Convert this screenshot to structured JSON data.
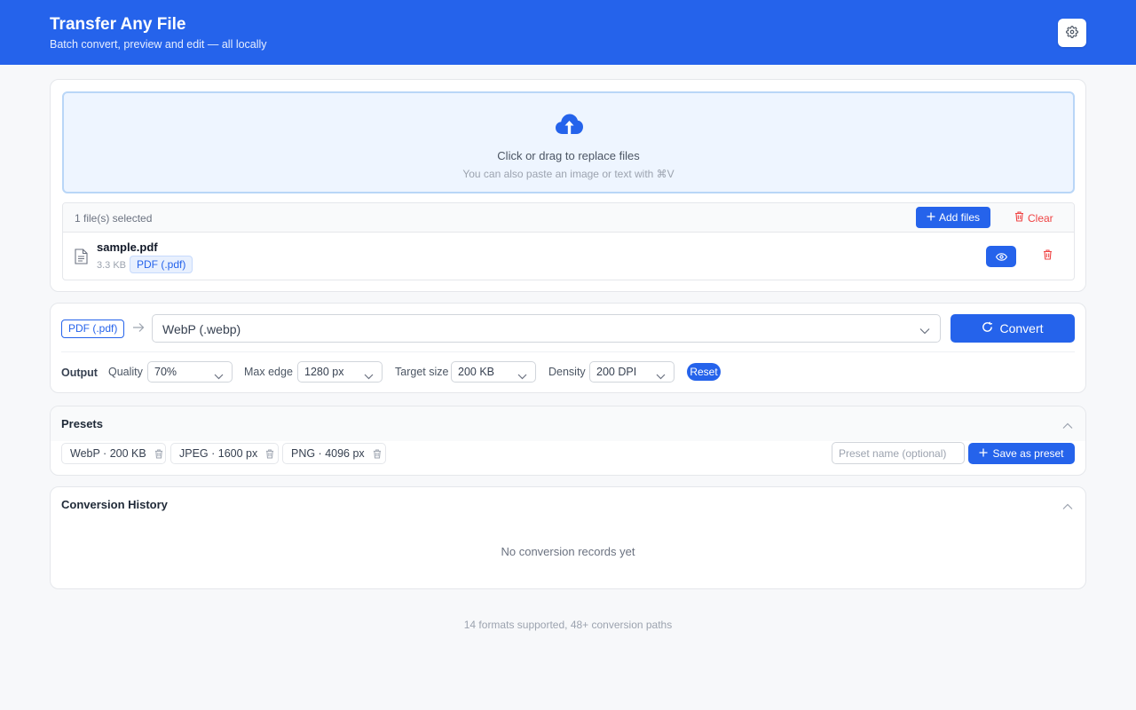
{
  "header": {
    "title": "Transfer Any File",
    "subtitle": "Batch convert, preview and edit — all locally"
  },
  "upload": {
    "main_text": "Click or drag to replace files",
    "hint": "You can also paste an image or text with ⌘V"
  },
  "file_list": {
    "count_text": "1 file(s) selected",
    "add_label": "Add files",
    "clear_label": "Clear",
    "files": [
      {
        "name": "sample.pdf",
        "size": "3.3 KB",
        "type": "PDF (.pdf)"
      }
    ]
  },
  "convert": {
    "source_format": "PDF (.pdf)",
    "target_format": "WebP (.webp)",
    "button_label": "Convert"
  },
  "output": {
    "label": "Output",
    "quality_label": "Quality",
    "quality_value": "70%",
    "max_edge_label": "Max edge",
    "max_edge_value": "1280 px",
    "target_size_label": "Target size",
    "target_size_value": "200 KB",
    "density_label": "Density",
    "density_value": "200 DPI",
    "reset_label": "Reset"
  },
  "presets": {
    "title": "Presets",
    "items": [
      "WebP · 200 KB",
      "JPEG · 1600 px",
      "PNG · 4096 px"
    ],
    "name_placeholder": "Preset name (optional)",
    "save_label": "Save as preset"
  },
  "history": {
    "title": "Conversion History",
    "empty_text": "No conversion records yet"
  },
  "footer": {
    "text": "14 formats supported, 48+ conversion paths"
  },
  "colors": {
    "accent": "#2563eb",
    "danger": "#ef4444",
    "background": "#f7f8fa"
  }
}
